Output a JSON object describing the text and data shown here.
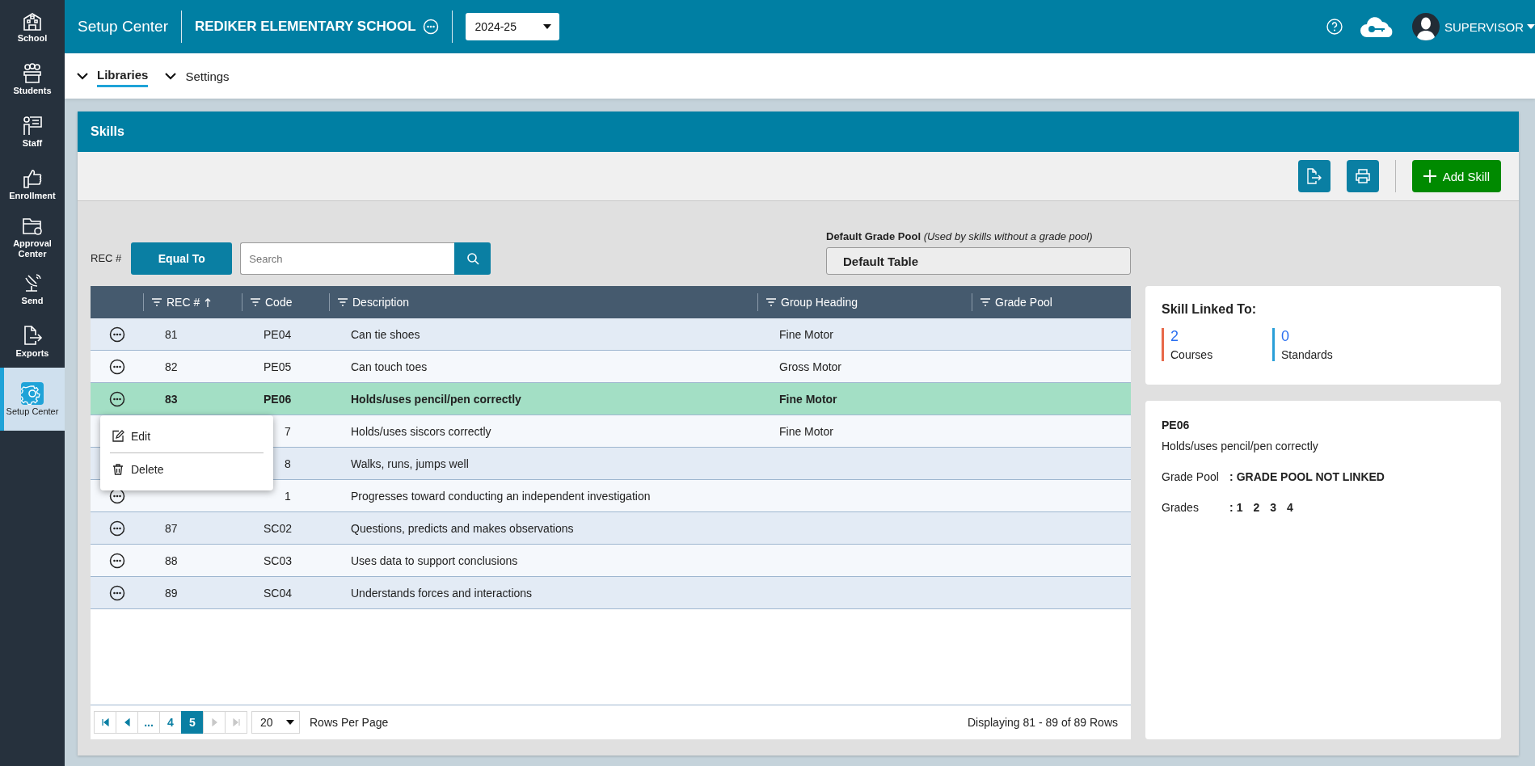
{
  "sidebar": {
    "items": [
      {
        "label": "School",
        "kind": "school",
        "selected": false
      },
      {
        "label": "Students",
        "kind": "students",
        "selected": false
      },
      {
        "label": "Staff",
        "kind": "staff",
        "selected": false
      },
      {
        "label": "Enrollment",
        "kind": "enrollment",
        "selected": false
      },
      {
        "label": "Approval Center",
        "kind": "approval",
        "selected": false
      },
      {
        "label": "Send",
        "kind": "send",
        "selected": false
      },
      {
        "label": "Exports",
        "kind": "exports",
        "selected": false
      },
      {
        "label": "Setup Center",
        "kind": "setup",
        "selected": true
      }
    ]
  },
  "header": {
    "app_title": "Setup Center",
    "school_name": "REDIKER ELEMENTARY SCHOOL",
    "year_select": "2024-25",
    "user": "SUPERVISOR"
  },
  "subnav": {
    "tabs": [
      {
        "label": "Libraries",
        "selected": true
      },
      {
        "label": "Settings",
        "selected": false
      }
    ]
  },
  "panel": {
    "title": "Skills",
    "add_button": "Add Skill"
  },
  "filter": {
    "field_label": "REC #",
    "operator_button": "Equal To",
    "search": {
      "placeholder": "Search"
    }
  },
  "grade_pool": {
    "label": "Default Grade Pool",
    "note": "(Used by skills without a grade pool)",
    "value": "Default Table"
  },
  "table": {
    "columns": [
      {
        "label": "REC #",
        "sorted": true
      },
      {
        "label": "Code",
        "sorted": false
      },
      {
        "label": "Description",
        "sorted": false
      },
      {
        "label": "Group Heading",
        "sorted": false
      },
      {
        "label": "Grade Pool",
        "sorted": false
      }
    ],
    "rows": [
      {
        "actions_button": true,
        "rec": "81",
        "code": "PE04",
        "description": "Can tie shoes",
        "group_heading": "Fine Motor",
        "selected": false
      },
      {
        "actions_button": true,
        "rec": "82",
        "code": "PE05",
        "description": "Can touch toes",
        "group_heading": "Gross Motor",
        "selected": false
      },
      {
        "actions_button": true,
        "rec": "83",
        "code": "PE06",
        "description": "Holds/uses pencil/pen correctly",
        "group_heading": "Fine Motor",
        "selected": true
      },
      {
        "actions_button": false,
        "code": "7",
        "description": "Holds/uses siscors correctly",
        "group_heading": "Fine Motor",
        "selected": false
      },
      {
        "actions_button": false,
        "code": "8",
        "description": "Walks, runs, jumps well",
        "selected": false
      },
      {
        "actions_button": true,
        "code": "1",
        "description": "Progresses toward conducting an independent investigation",
        "selected": false
      },
      {
        "actions_button": true,
        "rec": "87",
        "code": "SC02",
        "description": "Questions, predicts and makes observations",
        "selected": false
      },
      {
        "actions_button": true,
        "rec": "88",
        "code": "SC03",
        "description": "Uses data to support conclusions",
        "selected": false
      },
      {
        "actions_button": true,
        "rec": "89",
        "code": "SC04",
        "description": "Understands forces and interactions",
        "selected": false
      }
    ]
  },
  "row_menu": {
    "items": [
      {
        "kind": "edit",
        "label": "Edit"
      },
      {
        "kind": "delete",
        "label": "Delete"
      }
    ]
  },
  "pagination": {
    "nav": [
      {
        "kind": "first",
        "disabled": false
      },
      {
        "kind": "prev",
        "disabled": false
      },
      {
        "kind": "next",
        "disabled": true
      },
      {
        "kind": "last",
        "disabled": true
      }
    ],
    "pages": [
      {
        "label": "...",
        "selected": false
      },
      {
        "label": "4",
        "selected": false
      },
      {
        "label": "5",
        "selected": true
      }
    ],
    "rows_per_page": "20",
    "rows_per_page_label": "Rows Per Page",
    "summary": "Displaying 81 - 89 of 89 Rows"
  },
  "linked": {
    "title": "Skill Linked To:",
    "stats": [
      {
        "value": "2",
        "label": "Courses",
        "color": "#e8694a"
      },
      {
        "value": "0",
        "label": "Standards",
        "color": "#2a9fd8"
      }
    ]
  },
  "detail": {
    "code": "PE06",
    "description": "Holds/uses pencil/pen correctly",
    "grade_pool": {
      "label": "Grade Pool",
      "separator": ":",
      "value": "GRADE POOL NOT LINKED"
    },
    "grades": {
      "label": "Grades",
      "separator": ":",
      "values": [
        "1",
        "2",
        "3",
        "4"
      ]
    }
  }
}
